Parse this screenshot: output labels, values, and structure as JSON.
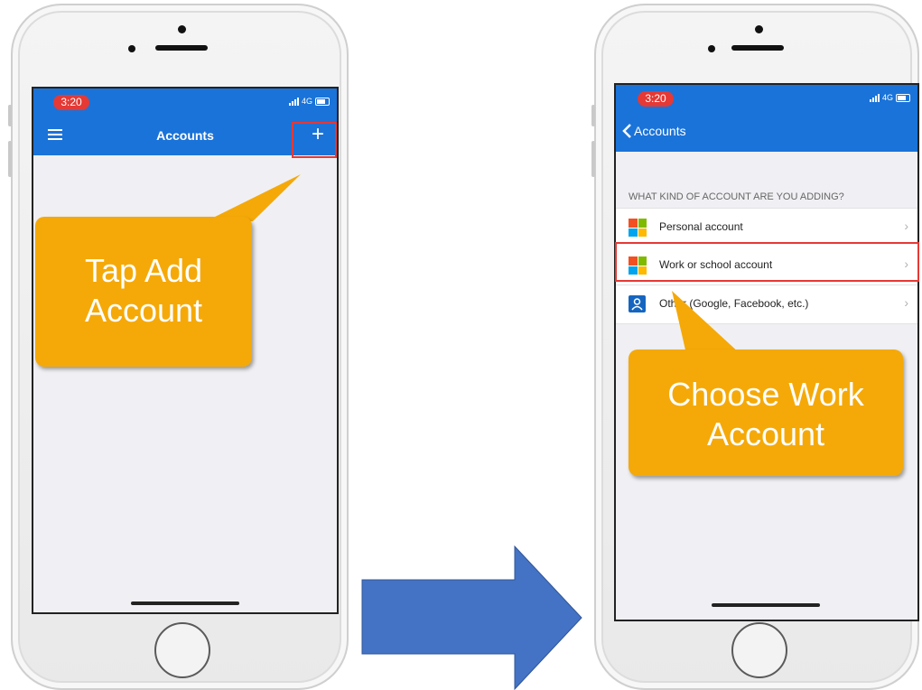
{
  "left_phone": {
    "status": {
      "time": "3:20",
      "network": "4G"
    },
    "nav": {
      "title": "Accounts",
      "add_icon": "+",
      "menu_icon": "hamburger-menu-icon"
    },
    "callout": {
      "line1": "Tap Add",
      "line2": "Account"
    }
  },
  "right_phone": {
    "status": {
      "time": "3:20",
      "network": "4G"
    },
    "nav": {
      "back_label": "Accounts",
      "back_icon": "chevron-left-icon"
    },
    "section_header": "WHAT KIND OF ACCOUNT ARE YOU ADDING?",
    "options": [
      {
        "label": "Personal account",
        "icon": "microsoft-logo-icon"
      },
      {
        "label": "Work or school account",
        "icon": "microsoft-logo-icon"
      },
      {
        "label": "Other (Google, Facebook, etc.)",
        "icon": "person-icon"
      }
    ],
    "callout": {
      "line1": "Choose Work",
      "line2": "Account"
    }
  },
  "arrow": {
    "icon": "right-arrow-icon",
    "color": "#4472c4"
  },
  "colors": {
    "accent": "#1a73d9",
    "callout": "#f5a908",
    "highlight": "#e53935"
  }
}
